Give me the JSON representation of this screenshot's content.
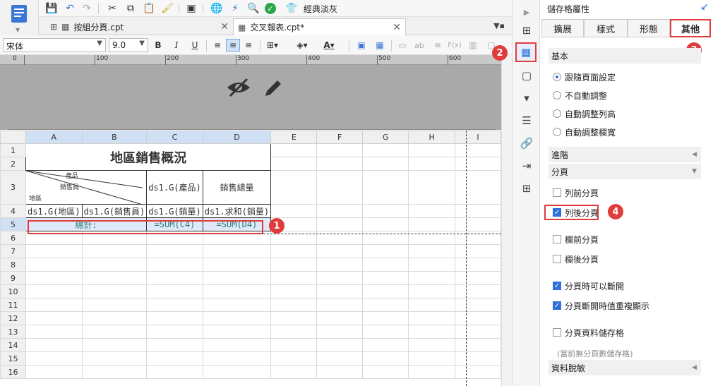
{
  "toolbar": {
    "theme_label": "經典淡灰",
    "icons": [
      "save-icon",
      "undo-icon",
      "redo-icon",
      "cut-icon",
      "copy-icon",
      "paste-icon",
      "format-painter-icon",
      "preview-icon",
      "globe-icon",
      "plugin-icon",
      "search-icon",
      "check-icon",
      "theme-icon"
    ]
  },
  "tabs": [
    {
      "label": "按組分頁.cpt",
      "active": false
    },
    {
      "label": "交叉報表.cpt*",
      "active": true
    }
  ],
  "format": {
    "font": "宋体",
    "size": "9.0",
    "bold": "B",
    "italic": "I",
    "underline": "U",
    "font_color_glyph": "A",
    "dim_ab": "ab",
    "dim_fx": "F(x)"
  },
  "ruler": {
    "unit": "0",
    "marks": [
      "100",
      "200",
      "300",
      "400",
      "500",
      "600"
    ]
  },
  "grid": {
    "columns": [
      "A",
      "B",
      "C",
      "D",
      "E",
      "F",
      "G",
      "H",
      "I"
    ],
    "rows": [
      "1",
      "2",
      "3",
      "4",
      "5",
      "6",
      "7",
      "8",
      "9",
      "10",
      "11",
      "12",
      "13",
      "14",
      "15",
      "16"
    ],
    "title": "地區銷售概況",
    "diag_product": "產品",
    "diag_salesperson": "銷售員",
    "diag_region": "地區",
    "c3": "ds1.G(產品)",
    "d3": "銷售總量",
    "a4": "ds1.G(地區)",
    "b4": "ds1.G(銷售員)",
    "c4": "ds1.G(銷量)",
    "d4": "ds1.求和(銷量)",
    "total_label": "總計:",
    "c5": "=SUM(C4)",
    "d5": "=SUM(D4)"
  },
  "badges": {
    "b1": "1",
    "b2": "2",
    "b3": "3",
    "b4": "4"
  },
  "panel": {
    "title": "儲存格屬性",
    "tabs": [
      "擴展",
      "樣式",
      "形態",
      "其他"
    ],
    "active_tab": "其他",
    "basic": "基本",
    "radios": [
      "跟隨頁面設定",
      "不自動調整",
      "自動調整列高",
      "自動調整欄寬"
    ],
    "radio_selected": 0,
    "advanced": "進階",
    "paging": "分頁",
    "checks": [
      {
        "label": "列前分頁",
        "checked": false
      },
      {
        "label": "列後分頁",
        "checked": true
      },
      {
        "label": "欄前分頁",
        "checked": false
      },
      {
        "label": "欄後分頁",
        "checked": false
      },
      {
        "label": "分頁時可以斷開",
        "checked": true
      },
      {
        "label": "分頁斷開時值重複顯示",
        "checked": true
      },
      {
        "label": "分頁資料儲存格",
        "checked": false
      }
    ],
    "hint": "(當前無分頁數儲存格)",
    "desensitize": "資料脫敏"
  },
  "colors": {
    "accent": "#2e6fd8",
    "highlight": "#e03c3c"
  }
}
